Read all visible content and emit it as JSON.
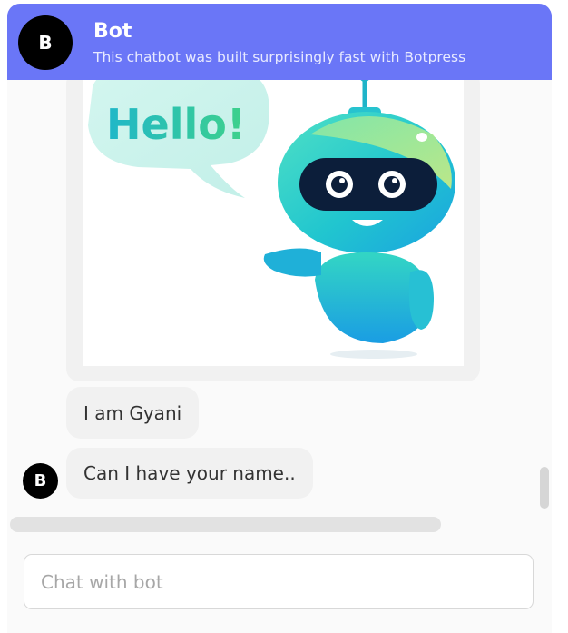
{
  "header": {
    "avatar_letter": "B",
    "title": "Bot",
    "subtitle": "This chatbot was built surprisingly fast with Botpress"
  },
  "messages": {
    "image": {
      "speech_text": "Hello!",
      "description": "cartoon robot waving"
    },
    "items": [
      {
        "text": "I am Gyani"
      },
      {
        "text": "Can I have your name.."
      }
    ],
    "avatar_letter": "B"
  },
  "composer": {
    "placeholder": "Chat with bot",
    "value": ""
  },
  "colors": {
    "header_bg": "#6a76f7",
    "bubble_bg": "#f1f1f1",
    "avatar_bg": "#000000"
  }
}
